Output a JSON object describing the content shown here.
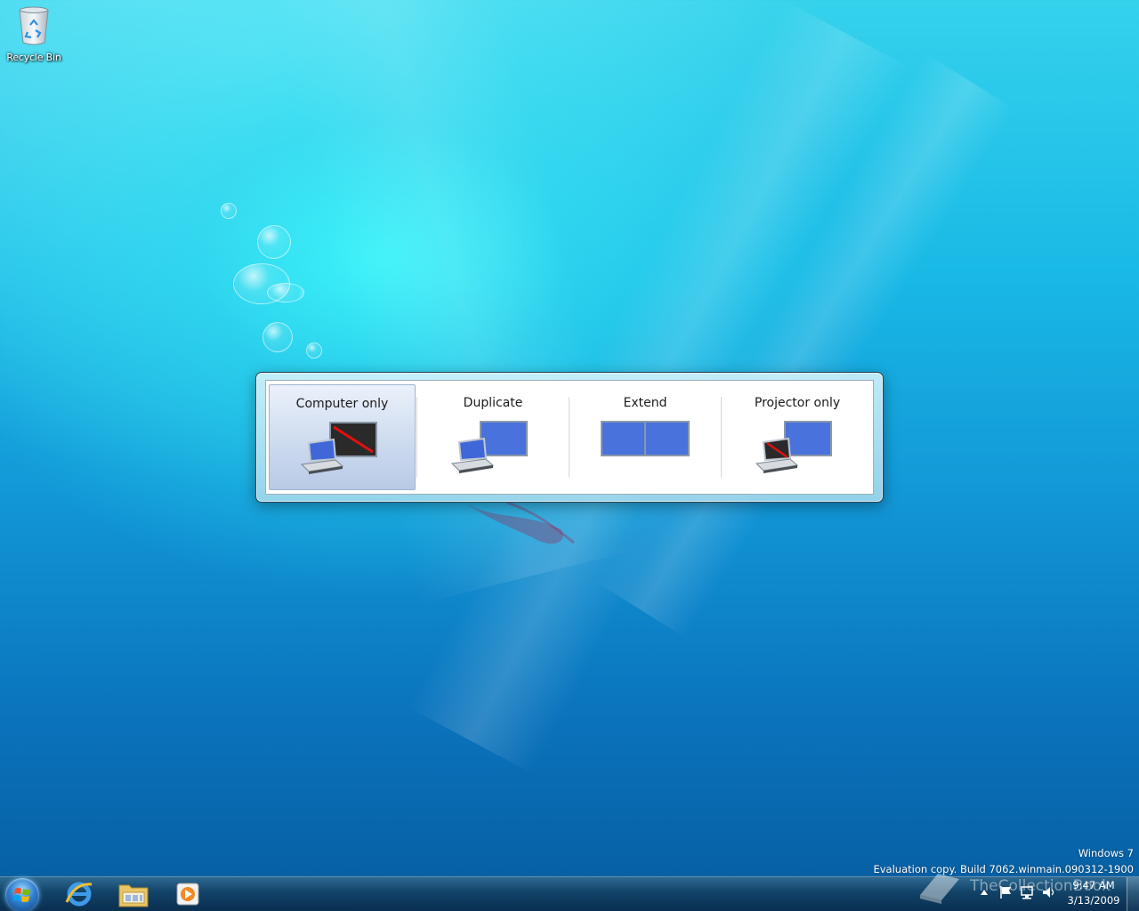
{
  "desktop": {
    "recycle_bin_label": "Recycle Bin"
  },
  "switcher": {
    "options": [
      {
        "label": "Computer only",
        "selected": true
      },
      {
        "label": "Duplicate",
        "selected": false
      },
      {
        "label": "Extend",
        "selected": false
      },
      {
        "label": "Projector only",
        "selected": false
      }
    ]
  },
  "watermark": {
    "line1": "Windows 7",
    "line2": "Evaluation copy. Build 7062.winmain.090312-1900",
    "site": "TheCollectionBook"
  },
  "taskbar": {
    "pinned": [
      "start-orb",
      "internet-explorer-icon",
      "windows-explorer-icon",
      "media-player-icon"
    ],
    "clock_time": "9:47 AM",
    "clock_date": "3/13/2009"
  },
  "colors": {
    "selected_option_top": "#ebf1fa",
    "selected_option_bottom": "#b9cae6",
    "screen_blue": "#3f67d8",
    "strike_red": "#e01010"
  }
}
